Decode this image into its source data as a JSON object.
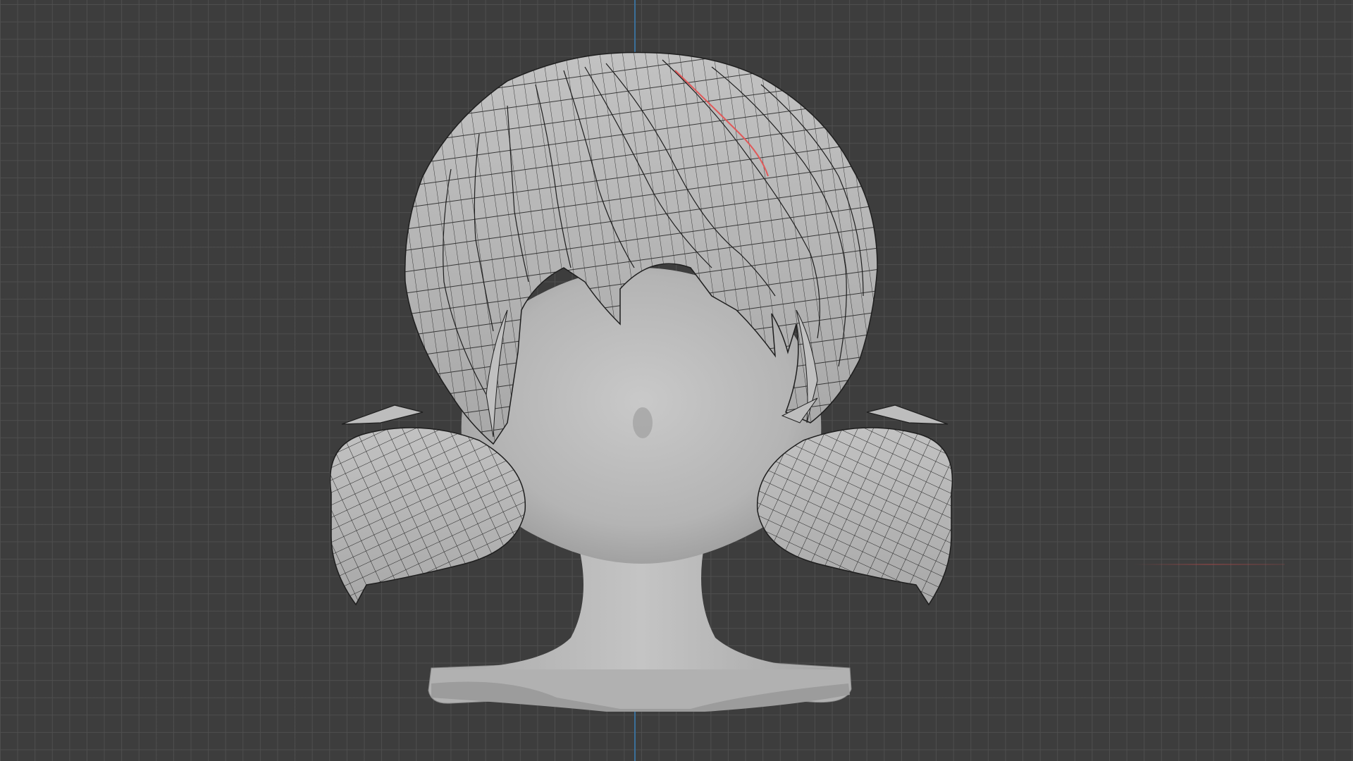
{
  "viewport": {
    "background_color": "#3d3d3d",
    "grid_color": "#505050",
    "axis_colors": {
      "z": "#3a6f9a",
      "x": "#9a4646"
    }
  },
  "model": {
    "shading": "solid",
    "overlay": "wireframe",
    "base_color": "#b9b9b9",
    "wire_color": "#1e1e1e",
    "selection_edge_color": "#e05a5a"
  }
}
